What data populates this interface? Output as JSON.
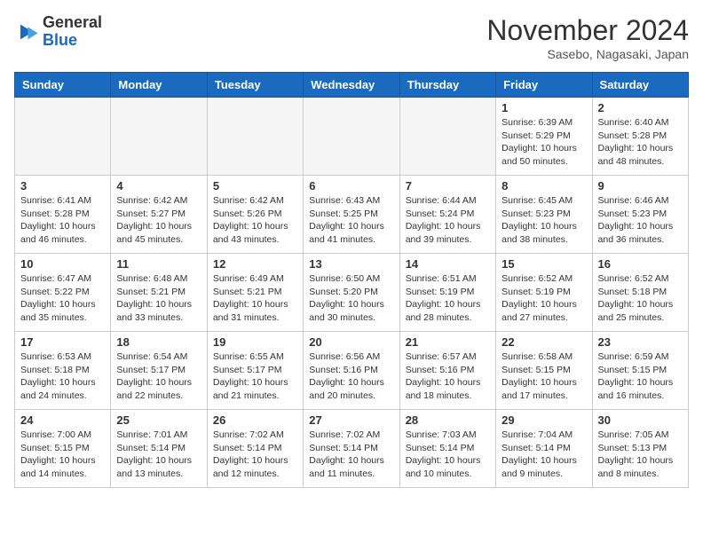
{
  "header": {
    "logo_line1": "General",
    "logo_line2": "Blue",
    "month": "November 2024",
    "location": "Sasebo, Nagasaki, Japan"
  },
  "weekdays": [
    "Sunday",
    "Monday",
    "Tuesday",
    "Wednesday",
    "Thursday",
    "Friday",
    "Saturday"
  ],
  "weeks": [
    [
      {
        "day": "",
        "info": ""
      },
      {
        "day": "",
        "info": ""
      },
      {
        "day": "",
        "info": ""
      },
      {
        "day": "",
        "info": ""
      },
      {
        "day": "",
        "info": ""
      },
      {
        "day": "1",
        "info": "Sunrise: 6:39 AM\nSunset: 5:29 PM\nDaylight: 10 hours\nand 50 minutes."
      },
      {
        "day": "2",
        "info": "Sunrise: 6:40 AM\nSunset: 5:28 PM\nDaylight: 10 hours\nand 48 minutes."
      }
    ],
    [
      {
        "day": "3",
        "info": "Sunrise: 6:41 AM\nSunset: 5:28 PM\nDaylight: 10 hours\nand 46 minutes."
      },
      {
        "day": "4",
        "info": "Sunrise: 6:42 AM\nSunset: 5:27 PM\nDaylight: 10 hours\nand 45 minutes."
      },
      {
        "day": "5",
        "info": "Sunrise: 6:42 AM\nSunset: 5:26 PM\nDaylight: 10 hours\nand 43 minutes."
      },
      {
        "day": "6",
        "info": "Sunrise: 6:43 AM\nSunset: 5:25 PM\nDaylight: 10 hours\nand 41 minutes."
      },
      {
        "day": "7",
        "info": "Sunrise: 6:44 AM\nSunset: 5:24 PM\nDaylight: 10 hours\nand 39 minutes."
      },
      {
        "day": "8",
        "info": "Sunrise: 6:45 AM\nSunset: 5:23 PM\nDaylight: 10 hours\nand 38 minutes."
      },
      {
        "day": "9",
        "info": "Sunrise: 6:46 AM\nSunset: 5:23 PM\nDaylight: 10 hours\nand 36 minutes."
      }
    ],
    [
      {
        "day": "10",
        "info": "Sunrise: 6:47 AM\nSunset: 5:22 PM\nDaylight: 10 hours\nand 35 minutes."
      },
      {
        "day": "11",
        "info": "Sunrise: 6:48 AM\nSunset: 5:21 PM\nDaylight: 10 hours\nand 33 minutes."
      },
      {
        "day": "12",
        "info": "Sunrise: 6:49 AM\nSunset: 5:21 PM\nDaylight: 10 hours\nand 31 minutes."
      },
      {
        "day": "13",
        "info": "Sunrise: 6:50 AM\nSunset: 5:20 PM\nDaylight: 10 hours\nand 30 minutes."
      },
      {
        "day": "14",
        "info": "Sunrise: 6:51 AM\nSunset: 5:19 PM\nDaylight: 10 hours\nand 28 minutes."
      },
      {
        "day": "15",
        "info": "Sunrise: 6:52 AM\nSunset: 5:19 PM\nDaylight: 10 hours\nand 27 minutes."
      },
      {
        "day": "16",
        "info": "Sunrise: 6:52 AM\nSunset: 5:18 PM\nDaylight: 10 hours\nand 25 minutes."
      }
    ],
    [
      {
        "day": "17",
        "info": "Sunrise: 6:53 AM\nSunset: 5:18 PM\nDaylight: 10 hours\nand 24 minutes."
      },
      {
        "day": "18",
        "info": "Sunrise: 6:54 AM\nSunset: 5:17 PM\nDaylight: 10 hours\nand 22 minutes."
      },
      {
        "day": "19",
        "info": "Sunrise: 6:55 AM\nSunset: 5:17 PM\nDaylight: 10 hours\nand 21 minutes."
      },
      {
        "day": "20",
        "info": "Sunrise: 6:56 AM\nSunset: 5:16 PM\nDaylight: 10 hours\nand 20 minutes."
      },
      {
        "day": "21",
        "info": "Sunrise: 6:57 AM\nSunset: 5:16 PM\nDaylight: 10 hours\nand 18 minutes."
      },
      {
        "day": "22",
        "info": "Sunrise: 6:58 AM\nSunset: 5:15 PM\nDaylight: 10 hours\nand 17 minutes."
      },
      {
        "day": "23",
        "info": "Sunrise: 6:59 AM\nSunset: 5:15 PM\nDaylight: 10 hours\nand 16 minutes."
      }
    ],
    [
      {
        "day": "24",
        "info": "Sunrise: 7:00 AM\nSunset: 5:15 PM\nDaylight: 10 hours\nand 14 minutes."
      },
      {
        "day": "25",
        "info": "Sunrise: 7:01 AM\nSunset: 5:14 PM\nDaylight: 10 hours\nand 13 minutes."
      },
      {
        "day": "26",
        "info": "Sunrise: 7:02 AM\nSunset: 5:14 PM\nDaylight: 10 hours\nand 12 minutes."
      },
      {
        "day": "27",
        "info": "Sunrise: 7:02 AM\nSunset: 5:14 PM\nDaylight: 10 hours\nand 11 minutes."
      },
      {
        "day": "28",
        "info": "Sunrise: 7:03 AM\nSunset: 5:14 PM\nDaylight: 10 hours\nand 10 minutes."
      },
      {
        "day": "29",
        "info": "Sunrise: 7:04 AM\nSunset: 5:14 PM\nDaylight: 10 hours\nand 9 minutes."
      },
      {
        "day": "30",
        "info": "Sunrise: 7:05 AM\nSunset: 5:13 PM\nDaylight: 10 hours\nand 8 minutes."
      }
    ]
  ]
}
